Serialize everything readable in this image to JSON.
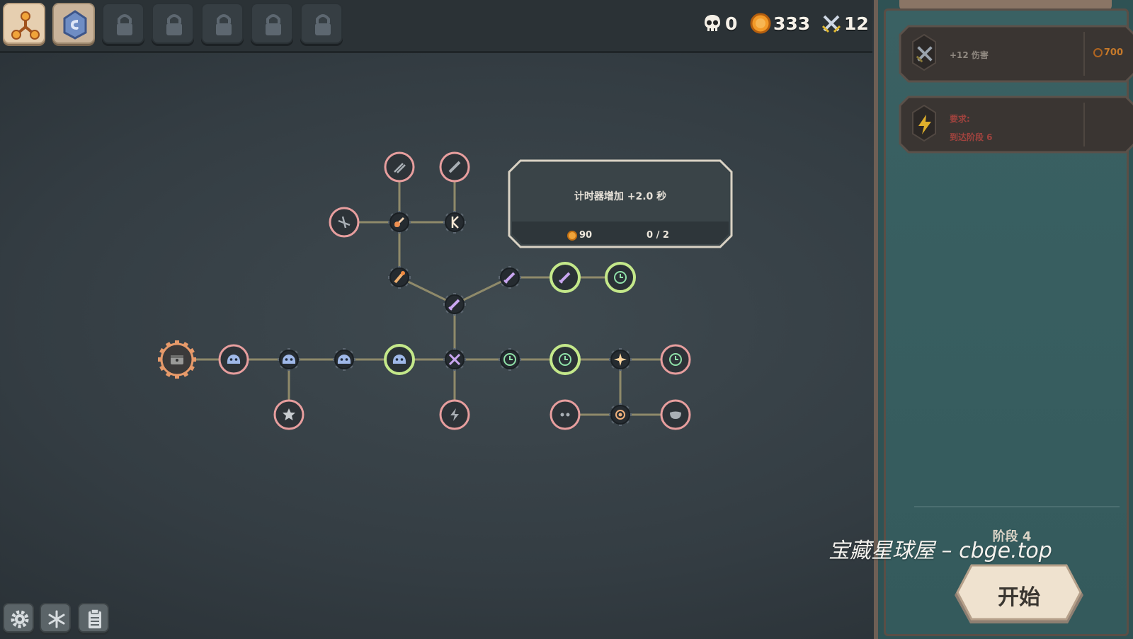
{
  "resources": {
    "kills": "0",
    "coins": "333",
    "damage": "12"
  },
  "tabs": [
    {
      "name": "skill-tree-tab",
      "icon": "tree-icon",
      "locked": false
    },
    {
      "name": "rune-tab",
      "icon": "rune-stone-icon",
      "locked": false
    },
    {
      "name": "locked-tab",
      "icon": "lock-icon",
      "locked": true
    },
    {
      "name": "locked-tab",
      "icon": "lock-icon",
      "locked": true
    },
    {
      "name": "locked-tab",
      "icon": "lock-icon",
      "locked": true
    },
    {
      "name": "locked-tab",
      "icon": "lock-icon",
      "locked": true
    },
    {
      "name": "locked-tab",
      "icon": "lock-icon",
      "locked": true
    }
  ],
  "tooltip": {
    "description": "计时器增加 +2.0 秒",
    "cost": "90",
    "level": "0 / 2"
  },
  "panel": {
    "card1": {
      "text": "+12 伤害",
      "cost": "700",
      "icon": "sword-damage-icon"
    },
    "card2": {
      "line1": "要求:",
      "line2": "到达阶段 6",
      "icon": "lightning-icon"
    },
    "stage": "阶段 4",
    "start_label": "开始"
  },
  "watermark": "宝藏星球屋 – cbge.top",
  "colors": {
    "locked_ring": "#e79e9e",
    "available_ring": "#c4e88a",
    "owned_fill": "#252b30",
    "connector": "#8f8a6a",
    "coin": "#f0a43a"
  },
  "nodes": [
    {
      "id": "root",
      "icon": "gear-chest-icon",
      "state": "start"
    },
    {
      "id": "n1",
      "icon": "slime-icon",
      "state": "locked"
    },
    {
      "id": "n2",
      "icon": "slime-icon",
      "state": "owned"
    },
    {
      "id": "n3",
      "icon": "slime-icon",
      "state": "owned"
    },
    {
      "id": "n4",
      "icon": "slime-icon",
      "state": "available"
    },
    {
      "id": "hub",
      "icon": "crossed-swords-icon",
      "state": "owned"
    },
    {
      "id": "n6",
      "icon": "clock-icon",
      "state": "owned"
    },
    {
      "id": "n7",
      "icon": "clock-icon",
      "state": "available"
    },
    {
      "id": "n8",
      "icon": "sparkle-icon",
      "state": "owned"
    },
    {
      "id": "n9",
      "icon": "clock-icon",
      "state": "locked"
    },
    {
      "id": "star",
      "icon": "star-icon",
      "state": "locked"
    },
    {
      "id": "bolt",
      "icon": "lightning-icon",
      "state": "locked"
    },
    {
      "id": "b1",
      "icon": "eyes-icon",
      "state": "locked"
    },
    {
      "id": "b2",
      "icon": "target-icon",
      "state": "owned"
    },
    {
      "id": "b3",
      "icon": "mask-icon",
      "state": "locked"
    },
    {
      "id": "sw",
      "icon": "sword-icon",
      "state": "owned"
    },
    {
      "id": "sw2",
      "icon": "sword-icon",
      "state": "owned"
    },
    {
      "id": "sw3",
      "icon": "sword-icon",
      "state": "available"
    },
    {
      "id": "sw4",
      "icon": "clock-icon",
      "state": "available"
    },
    {
      "id": "flame",
      "icon": "flame-sword-icon",
      "state": "owned"
    },
    {
      "id": "fire",
      "icon": "fire-fist-icon",
      "state": "owned"
    },
    {
      "id": "arrows",
      "icon": "arrows-icon",
      "state": "locked"
    },
    {
      "id": "blade",
      "icon": "blade-icon",
      "state": "locked"
    },
    {
      "id": "bow",
      "icon": "crossbow-icon",
      "state": "locked"
    },
    {
      "id": "rune",
      "icon": "rune-k-icon",
      "state": "owned"
    }
  ]
}
